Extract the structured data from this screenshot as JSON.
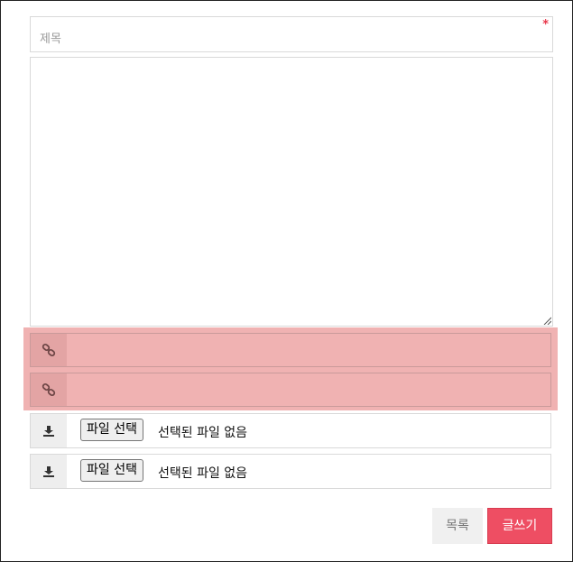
{
  "form": {
    "title_placeholder": "제목",
    "required_mark": "*",
    "link_rows": [
      {
        "icon": "link-icon",
        "value": ""
      },
      {
        "icon": "link-icon",
        "value": ""
      }
    ],
    "file_rows": [
      {
        "icon": "download-icon",
        "button_label": "파일 선택",
        "status": "선택된 파일 없음"
      },
      {
        "icon": "download-icon",
        "button_label": "파일 선택",
        "status": "선택된 파일 없음"
      }
    ]
  },
  "actions": {
    "list_label": "목록",
    "write_label": "글쓰기"
  },
  "colors": {
    "accent": "#ee4e63",
    "required": "#e8364a",
    "highlight": "#f0b2b2"
  }
}
